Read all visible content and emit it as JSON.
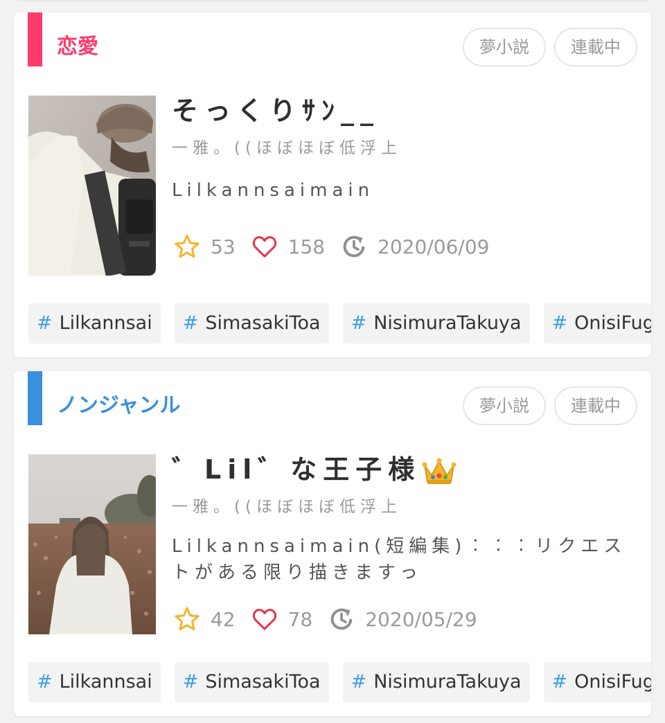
{
  "colors": {
    "romance": "#ff3b6b",
    "nongenre": "#3b8fde",
    "star": "#f3b52a",
    "heart": "#e8334a",
    "hash": "#3b9ee0"
  },
  "stories": [
    {
      "genre": "恋愛",
      "badges": [
        "夢小説",
        "連載中"
      ],
      "title": "そっくりｻﾝ__",
      "author": "一雅。((ほぼほぼ低浮上",
      "description": "Lilkannsaimain",
      "stars": "53",
      "hearts": "158",
      "updated": "2020/06/09",
      "tags": [
        "Lilkannsai",
        "SimasakiToa",
        "NisimuraTakuya",
        "OnisiFuga"
      ],
      "icons": {
        "star": "star-icon",
        "heart": "heart-icon",
        "update": "update-clock-icon"
      }
    },
    {
      "genre": "ノンジャンル",
      "badges": [
        "夢小説",
        "連載中"
      ],
      "title": "゛Lil゛な王子様",
      "title_emoji": "crown-icon",
      "author": "一雅。((ほぼほぼ低浮上",
      "description": "Lilkannsaimain(短編集)︰︰︰リクエストがある限り描きますっ",
      "stars": "42",
      "hearts": "78",
      "updated": "2020/05/29",
      "tags": [
        "Lilkannsai",
        "SimasakiToa",
        "NisimuraTakuya",
        "OnisiFuga"
      ],
      "icons": {
        "star": "star-icon",
        "heart": "heart-icon",
        "update": "update-clock-icon"
      }
    }
  ]
}
